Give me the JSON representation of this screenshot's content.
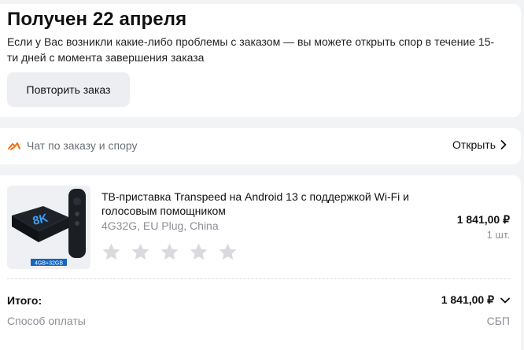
{
  "status": {
    "title": "Получен 22 апреля",
    "text": "Если у Вас возникли какие-либо проблемы с заказом — вы можете открыть спор в течение 15-ти дней с момента завершения заказа",
    "repeat_button": "Повторить заказ"
  },
  "chat": {
    "icon": "handshake-icon",
    "label": "Чат по заказу и спору",
    "open_label": "Открыть",
    "accent": "#ff6a00"
  },
  "product": {
    "title": "ТВ-приставка Transpeed на Android 13 с поддержкой Wi-Fi и голосовым помощником",
    "variant": "4G32G, EU Plug, China",
    "price": "1 841,00 ₽",
    "quantity": "1 шт.",
    "rating_stars": 5,
    "rating_value": 0,
    "image_badge": "8K",
    "image_caption": "4GB+32GB"
  },
  "summary": {
    "total_label": "Итого:",
    "total_value": "1 841,00 ₽",
    "payment_label": "Способ оплаты",
    "payment_value": "СБП"
  }
}
